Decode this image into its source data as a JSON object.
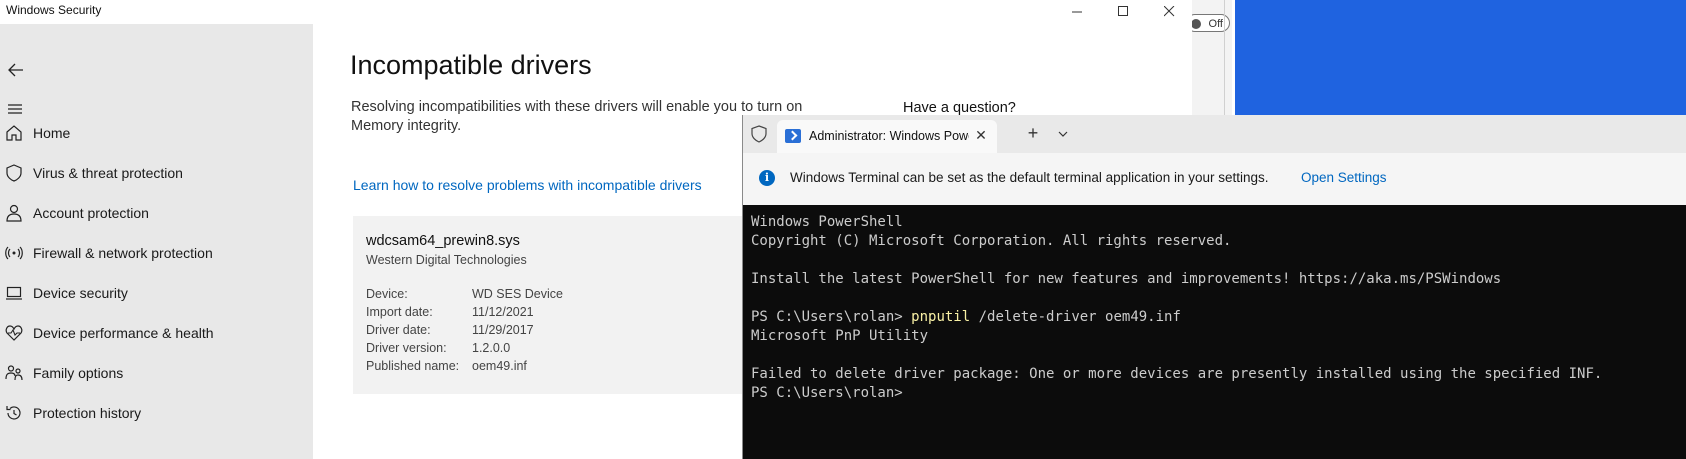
{
  "windows_security": {
    "title": "Windows Security",
    "nav": [
      {
        "label": "Home",
        "icon": "home-icon"
      },
      {
        "label": "Virus & threat protection",
        "icon": "shield-icon"
      },
      {
        "label": "Account protection",
        "icon": "person-icon"
      },
      {
        "label": "Firewall & network protection",
        "icon": "wifi-icon"
      },
      {
        "label": "Device security",
        "icon": "laptop-icon"
      },
      {
        "label": "Device performance & health",
        "icon": "heart-pulse-icon"
      },
      {
        "label": "Family options",
        "icon": "family-icon"
      },
      {
        "label": "Protection history",
        "icon": "history-icon"
      }
    ],
    "main": {
      "title": "Incompatible drivers",
      "description": "Resolving incompatibilities with these drivers will enable you to turn on Memory integrity.",
      "help_heading": "Have a question?",
      "learn_link": "Learn how to resolve problems with incompatible drivers",
      "driver": {
        "name": "wdcsam64_prewin8.sys",
        "vendor": "Western Digital Technologies",
        "details": [
          {
            "key": "Device:",
            "value": "WD SES Device"
          },
          {
            "key": "Import date:",
            "value": "11/12/2021"
          },
          {
            "key": "Driver date:",
            "value": "11/29/2017"
          },
          {
            "key": "Driver version:",
            "value": "1.2.0.0"
          },
          {
            "key": "Published name:",
            "value": "oem49.inf"
          }
        ]
      }
    }
  },
  "background": {
    "toggle_label": "Off"
  },
  "terminal": {
    "tab_title": "Administrator: Windows PowerShell",
    "info_text": "Windows Terminal can be set as the default terminal application in your settings.",
    "info_link": "Open Settings",
    "lines": {
      "l1": "Windows PowerShell",
      "l2": "Copyright (C) Microsoft Corporation. All rights reserved.",
      "l3": "Install the latest PowerShell for new features and improvements! https://aka.ms/PSWindows",
      "l4_prompt": "PS C:\\Users\\rolan> ",
      "l4_cmd": "pnputil",
      "l4_args": " /delete-driver oem49.inf",
      "l5": "Microsoft PnP Utility",
      "l6": "Failed to delete driver package: One or more devices are presently installed using the specified INF.",
      "l7": "PS C:\\Users\\rolan>"
    }
  }
}
